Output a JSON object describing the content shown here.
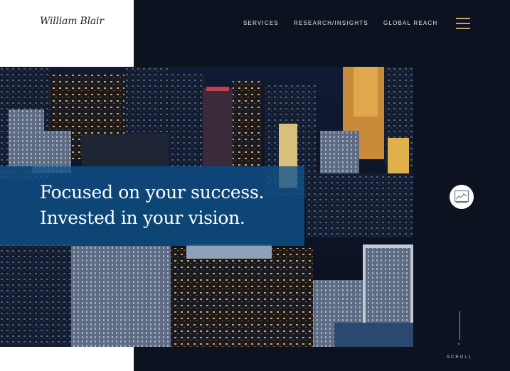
{
  "brand": {
    "name": "William Blair"
  },
  "nav": {
    "items": [
      {
        "label": "SERVICES"
      },
      {
        "label": "RESEARCH/INSIGHTS"
      },
      {
        "label": "GLOBAL REACH"
      }
    ],
    "menu_icon": "hamburger-icon"
  },
  "hero": {
    "headline_line1": "Focused on your success.",
    "headline_line2": "Invested in your vision.",
    "image_icon": "city-skyline-photo"
  },
  "side_button": {
    "icon": "chart-icon"
  },
  "scroll": {
    "label": "SCROLL",
    "icon": "chevron-down-icon"
  },
  "colors": {
    "background": "#0d1220",
    "accent_gold": "#c9a36a",
    "overlay_blue": "#0e538c",
    "text_light": "#e8e9ee"
  }
}
